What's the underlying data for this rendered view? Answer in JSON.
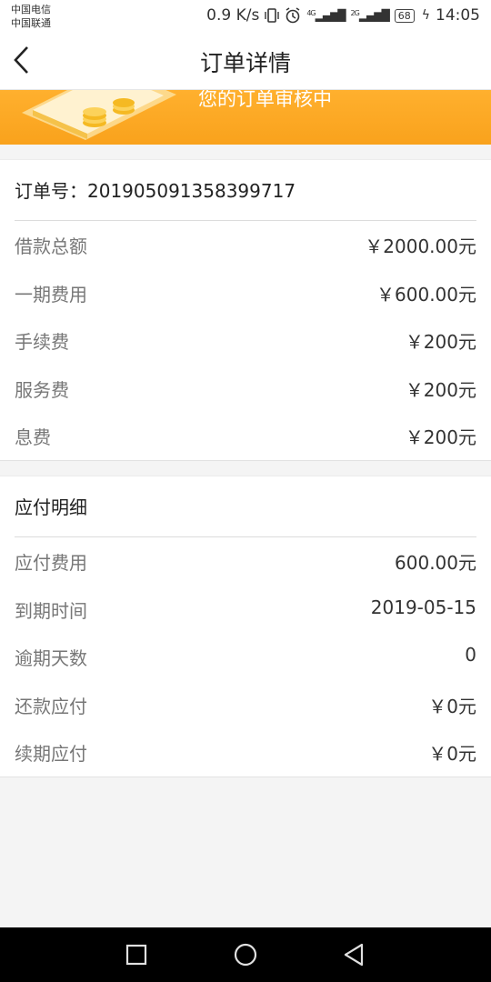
{
  "status_bar": {
    "carrier1": "中国电信",
    "carrier2": "中国联通",
    "speed": "0.9 K/s",
    "net1": "4G",
    "net2": "2G",
    "battery": "68",
    "time": "14:05"
  },
  "nav": {
    "title": "订单详情"
  },
  "banner": {
    "text": "您的订单审核中"
  },
  "order": {
    "number": "订单号：201905091358399717",
    "rows": [
      {
        "label": "借款总额",
        "value": "￥2000.00元"
      },
      {
        "label": "一期费用",
        "value": "￥600.00元"
      },
      {
        "label": "手续费",
        "value": "￥200元"
      },
      {
        "label": "服务费",
        "value": "￥200元"
      },
      {
        "label": "息费",
        "value": "￥200元"
      }
    ]
  },
  "payable": {
    "title": "应付明细",
    "rows": [
      {
        "label": "应付费用",
        "value": "600.00元"
      },
      {
        "label": "到期时间",
        "value": "2019-05-15"
      },
      {
        "label": "逾期天数",
        "value": "0"
      },
      {
        "label": "还款应付",
        "value": "￥0元"
      },
      {
        "label": "续期应付",
        "value": "￥0元"
      }
    ]
  },
  "icons": {
    "back": "chevron-left-icon",
    "recent": "square-icon",
    "home": "circle-icon",
    "back_nav": "triangle-left-icon"
  },
  "colors": {
    "accent": "#f9a21c"
  }
}
